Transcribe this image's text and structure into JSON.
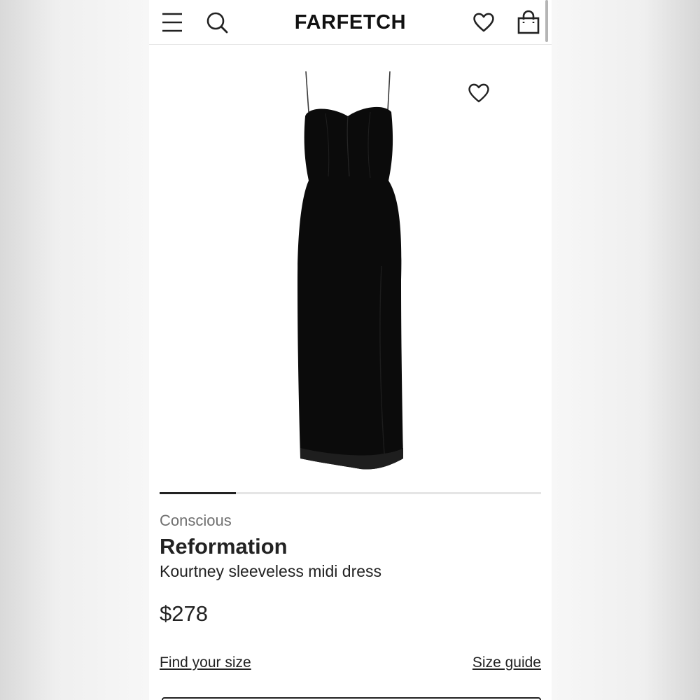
{
  "header": {
    "logo": "FARFETCH",
    "icons": [
      "menu-icon",
      "search-icon",
      "wishlist-heart-icon",
      "shopping-bag-icon"
    ]
  },
  "gallery": {
    "image_alt": "Kourtney sleeveless midi dress",
    "wishlist_icon": "heart-outline-icon",
    "progress_fraction": 0.2
  },
  "product": {
    "category": "Conscious",
    "brand": "Reformation",
    "name": "Kourtney sleeveless midi dress",
    "price": "$278"
  },
  "links": {
    "find_size": "Find your size",
    "size_guide": "Size guide"
  },
  "colors": {
    "text": "#222222",
    "muted": "#6f6f6f",
    "progress_track": "#e5e5e5"
  }
}
